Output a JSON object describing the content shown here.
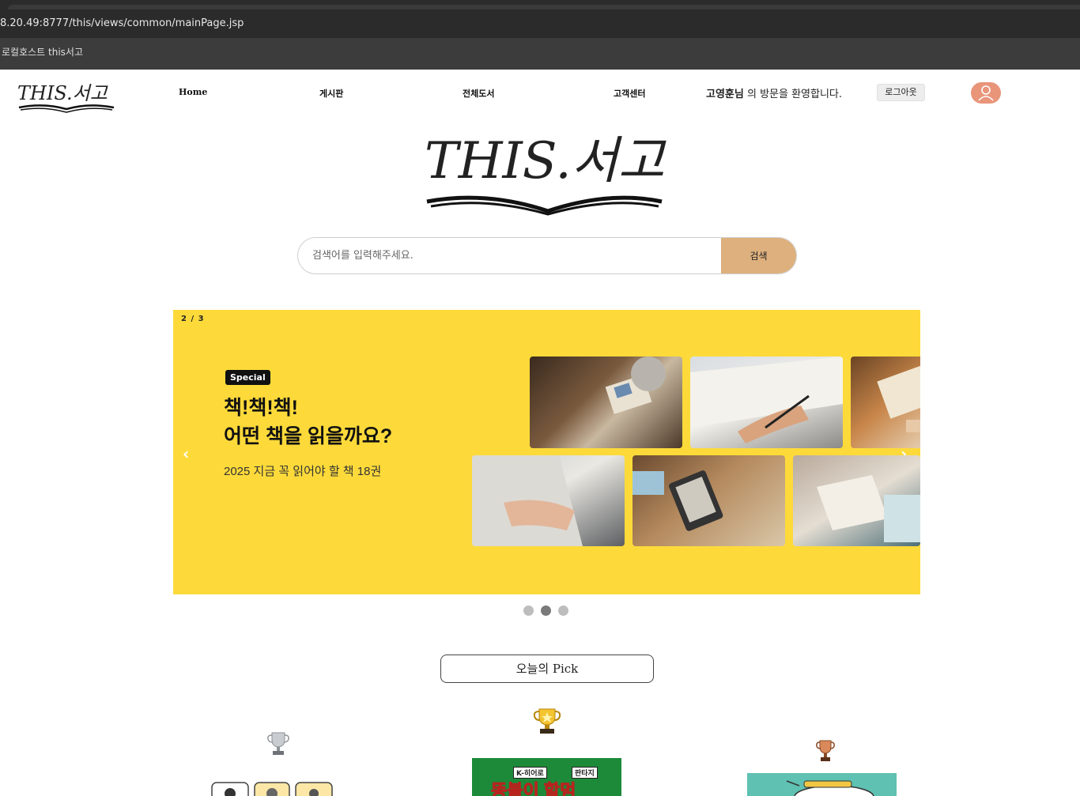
{
  "browser": {
    "url": "8.20.49:8777/this/views/common/mainPage.jsp",
    "bookmark": "로컬호스트 this서고"
  },
  "nav": {
    "logo_text": "THIS.서고",
    "items": [
      "Home",
      "게시판",
      "전체도서",
      "고객센터"
    ],
    "welcome_name": "고영훈님",
    "welcome_rest": " 의 방문을 환영합니다.",
    "logout_label": "로그아웃"
  },
  "hero": {
    "logo_text": "THIS.서고"
  },
  "search": {
    "placeholder": "검색어를 입력해주세요.",
    "button_label": "검색"
  },
  "banner": {
    "counter": "2 / 3",
    "badge": "Special",
    "headline_line1": "책!책!책!",
    "headline_line2": "어떤 책을 읽을까요?",
    "subline": "2025 지금 꼭 읽어야 할 책 18권",
    "prev": "‹",
    "next": "›",
    "background": "#fdda3a",
    "active_slide": 2,
    "total_slides": 3
  },
  "pick": {
    "label": "오늘의 Pick",
    "book2_title": "똥볼이 할멈",
    "book2_tag_left": "K-히어로",
    "book2_tag_right": "판타지"
  }
}
